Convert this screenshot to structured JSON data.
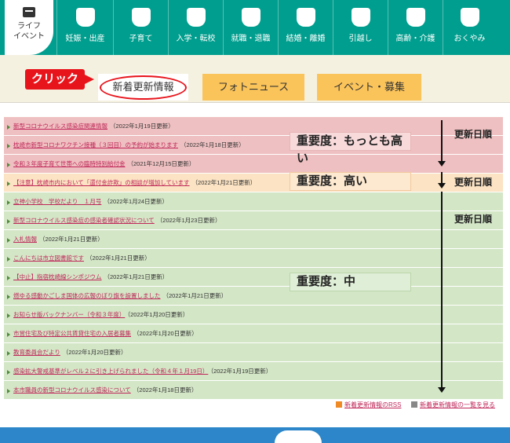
{
  "nav": {
    "life_label": "ライフ\nイベント",
    "items": [
      {
        "label": "妊娠・出産",
        "icon": "pregnancy-icon"
      },
      {
        "label": "子育て",
        "icon": "childcare-icon"
      },
      {
        "label": "入学・転校",
        "icon": "school-icon"
      },
      {
        "label": "就職・退職",
        "icon": "employment-icon"
      },
      {
        "label": "結婚・離婚",
        "icon": "marriage-icon"
      },
      {
        "label": "引越し",
        "icon": "moving-icon"
      },
      {
        "label": "高齢・介護",
        "icon": "elderly-care-icon"
      },
      {
        "label": "おくやみ",
        "icon": "condolence-icon"
      }
    ]
  },
  "tabs": {
    "click_badge": "クリック",
    "active": "新着更新情報",
    "photo": "フォトニュース",
    "event": "イベント・募集"
  },
  "news": [
    {
      "title": "新型コロナウイルス感染症関連情報",
      "date": "（2022年1月19日更新）",
      "level": "red"
    },
    {
      "title": "枕崎市新型コロナワクチン接種（３回目）の予約が始まります",
      "date": "（2022年1月18日更新）",
      "level": "red"
    },
    {
      "title": "令和３年度子育て世帯への臨時特別給付金",
      "date": "（2021年12月15日更新）",
      "level": "red"
    },
    {
      "title": "【注意】枕崎市内において「還付金詐欺」の相談が増加しています",
      "date": "（2022年1月21日更新）",
      "level": "orange"
    },
    {
      "title": "立神小学校　学校だより　１月号",
      "date": "（2022年1月24日更新）",
      "level": "green"
    },
    {
      "title": "新型コロナウイルス感染症の感染者確認状況について",
      "date": "（2022年1月23日更新）",
      "level": "green"
    },
    {
      "title": "入札情報",
      "date": "（2022年1月21日更新）",
      "level": "green"
    },
    {
      "title": "こんにちは市立図書館です",
      "date": "（2022年1月21日更新）",
      "level": "green"
    },
    {
      "title": "【中止】指宿枕崎線シンポジウム",
      "date": "（2022年1月21日更新）",
      "level": "green"
    },
    {
      "title": "燃ゆる感動かごしま国体の広報のぼり旗を設置しました",
      "date": "（2022年1月21日更新）",
      "level": "green"
    },
    {
      "title": "お知らせ版バックナンバー（令和３年度）",
      "date": "（2022年1月20日更新）",
      "level": "green"
    },
    {
      "title": "市営住宅及び特定公共賃貸住宅の入居者募集",
      "date": "（2022年1月20日更新）",
      "level": "green"
    },
    {
      "title": "教育委員会だより",
      "date": "（2022年1月20日更新）",
      "level": "green"
    },
    {
      "title": "感染拡大警戒基準がレベル２に引き上げられました（令和４年１月19日）",
      "date": "（2022年1月19日更新）",
      "level": "green"
    },
    {
      "title": "本市職員の新型コロナウイルス感染について",
      "date": "（2022年1月18日更新）",
      "level": "green"
    }
  ],
  "annotations": {
    "highest": "重要度：もっとも高い",
    "high": "重要度：高い",
    "medium": "重要度：中",
    "order": "更新日順"
  },
  "footer": {
    "rss": "新着更新情報のRSS",
    "more": "新着更新情報の一覧を見る"
  }
}
